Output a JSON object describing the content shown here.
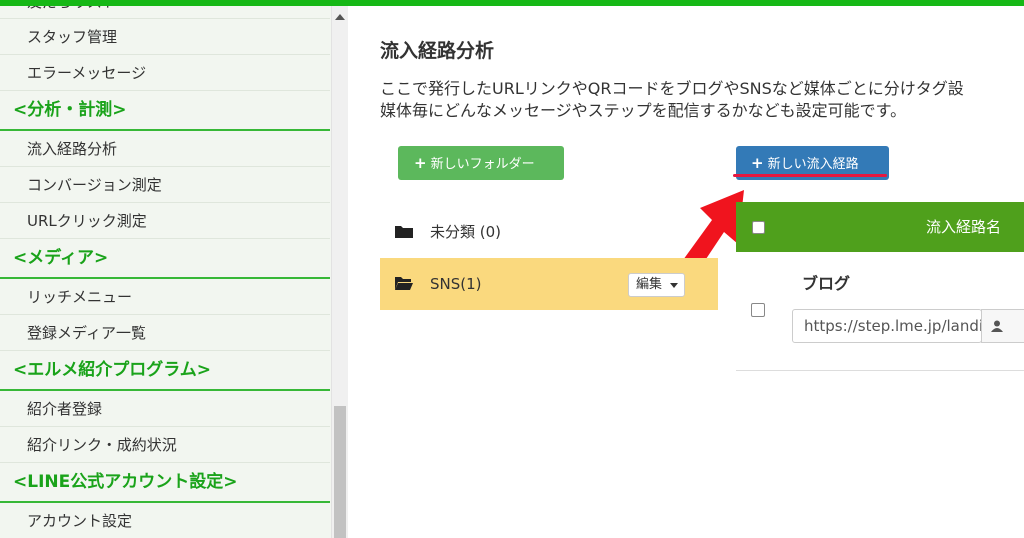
{
  "sidebar": {
    "items_top": [
      "友だちリスト",
      "スタッフ管理",
      "エラーメッセージ"
    ],
    "section_analysis": "<分析・計測>",
    "items_analysis": [
      "流入経路分析",
      "コンバージョン測定",
      "URLクリック測定"
    ],
    "section_media": "<メディア>",
    "items_media": [
      "リッチメニュー",
      "登録メディア一覧"
    ],
    "section_referral": "<エルメ紹介プログラム>",
    "items_referral": [
      "紹介者登録",
      "紹介リンク・成約状況"
    ],
    "section_line": "<LINE公式アカウント設定>",
    "items_line": [
      "アカウント設定"
    ]
  },
  "main": {
    "title": "流入経路分析",
    "description_line1": "ここで発行したURLリンクやQRコードをブログやSNSなど媒体ごとに分けタグ設",
    "description_line2": "媒体毎にどんなメッセージやステップを配信するかなども設定可能です。",
    "new_folder_button": "新しいフォルダー",
    "new_route_button": "新しい流入経路",
    "folders": [
      {
        "label": "未分類 (0)"
      },
      {
        "label": "SNS(1)",
        "edit_label": "編集"
      }
    ],
    "table": {
      "header_name": "流入経路名",
      "rows": [
        {
          "name": "ブログ",
          "url": "https://step.lme.jp/landing"
        }
      ]
    }
  },
  "colors": {
    "accent_green": "#16b816",
    "route_button_blue": "#337ab7",
    "folder_button_green": "#5cb85c",
    "selected_folder": "#fad97e",
    "table_header_green": "#4fa01c",
    "arrow_red": "#f0141e"
  }
}
